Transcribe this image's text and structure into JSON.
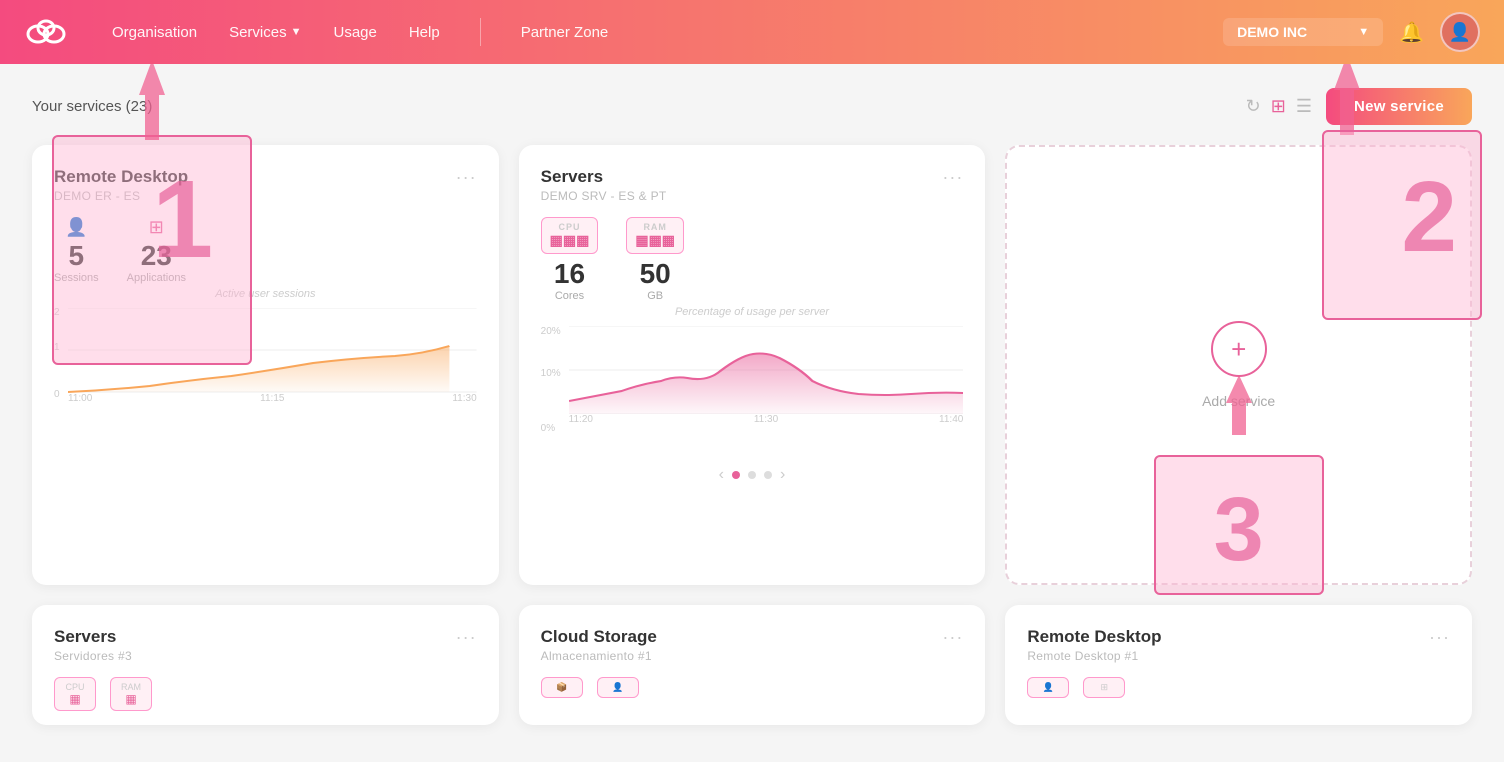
{
  "navbar": {
    "logo_alt": "Cloud logo",
    "links": [
      {
        "label": "Organisation",
        "active": false
      },
      {
        "label": "Services",
        "active": true,
        "has_dropdown": true
      },
      {
        "label": "Usage",
        "active": false
      },
      {
        "label": "Help",
        "active": false
      }
    ],
    "partner_zone": "Partner Zone",
    "company": "DEMO INC",
    "bell_icon": "🔔",
    "avatar_icon": "👤"
  },
  "page": {
    "services_title": "Your services (23)",
    "view_icons": [
      "refresh",
      "grid",
      "list"
    ],
    "new_service_label": "New service"
  },
  "cards": [
    {
      "id": "card-remote-desktop",
      "title": "Remote Desktop",
      "subtitle": "DEMO ER - ES",
      "menu": "···",
      "stats": [
        {
          "icon": "user",
          "number": "5",
          "label": "Sessions"
        },
        {
          "icon": "grid",
          "number": "23",
          "label": "Applications"
        }
      ],
      "desc": "Active user sessions",
      "chart_type": "line",
      "chart_ylabels": [
        "2",
        "1",
        "0"
      ],
      "chart_xlabels": [
        "11:00",
        "11:15",
        "11:30"
      ]
    },
    {
      "id": "card-servers",
      "title": "Servers",
      "subtitle": "DEMO SRV - ES & PT",
      "menu": "···",
      "stats": [
        {
          "icon": "cpu",
          "number": "16",
          "label": "Cores"
        },
        {
          "icon": "ram",
          "number": "50",
          "label": "GB"
        }
      ],
      "desc": "Percentage of usage per server",
      "chart_type": "area",
      "chart_ylabels": [
        "20%",
        "10%",
        "0%"
      ],
      "chart_xlabels": [
        "11:20",
        "11:30",
        "11:40"
      ]
    },
    {
      "id": "card-add",
      "type": "add",
      "add_label": "Add service"
    }
  ],
  "bottom_cards": [
    {
      "title": "Servers",
      "subtitle": "Servidores #3",
      "menu": "···"
    },
    {
      "title": "Cloud Storage",
      "subtitle": "Almacenamiento #1",
      "menu": "···"
    },
    {
      "title": "Remote Desktop",
      "subtitle": "Remote Desktop #1",
      "menu": "···"
    }
  ],
  "annotations": {
    "1_label": "1",
    "2_label": "2",
    "3_label": "3"
  }
}
